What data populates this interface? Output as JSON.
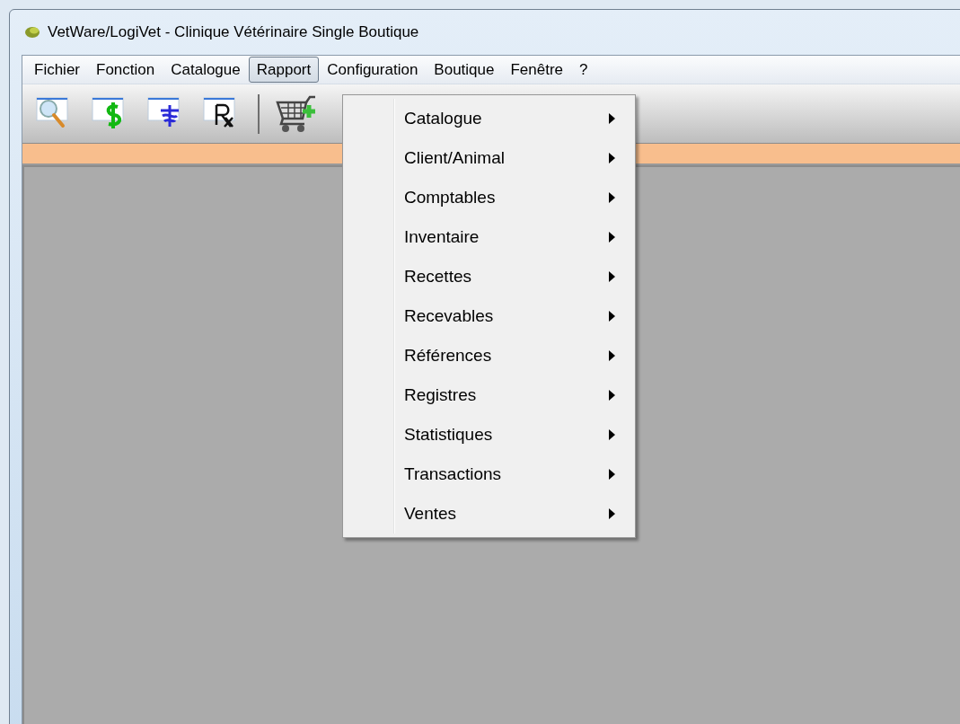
{
  "window": {
    "title": "VetWare/LogiVet - Clinique Vétérinaire Single Boutique"
  },
  "menu_bar": [
    {
      "label": "Fichier",
      "selected": false
    },
    {
      "label": "Fonction",
      "selected": false
    },
    {
      "label": "Catalogue",
      "selected": false
    },
    {
      "label": "Rapport",
      "selected": true
    },
    {
      "label": "Configuration",
      "selected": false
    },
    {
      "label": "Boutique",
      "selected": false
    },
    {
      "label": "Fenêtre",
      "selected": false
    },
    {
      "label": "?",
      "selected": false
    }
  ],
  "toolbar": [
    {
      "kind": "search"
    },
    {
      "kind": "dollar"
    },
    {
      "kind": "caduceus"
    },
    {
      "kind": "rx"
    },
    {
      "kind": "separator"
    },
    {
      "kind": "cart"
    }
  ],
  "dropdown_menu": [
    {
      "label": "Catalogue"
    },
    {
      "label": "Client/Animal"
    },
    {
      "label": "Comptables"
    },
    {
      "label": "Inventaire"
    },
    {
      "label": "Recettes"
    },
    {
      "label": "Recevables"
    },
    {
      "label": "Références"
    },
    {
      "label": "Registres"
    },
    {
      "label": "Statistiques"
    },
    {
      "label": "Transactions"
    },
    {
      "label": "Ventes"
    }
  ]
}
